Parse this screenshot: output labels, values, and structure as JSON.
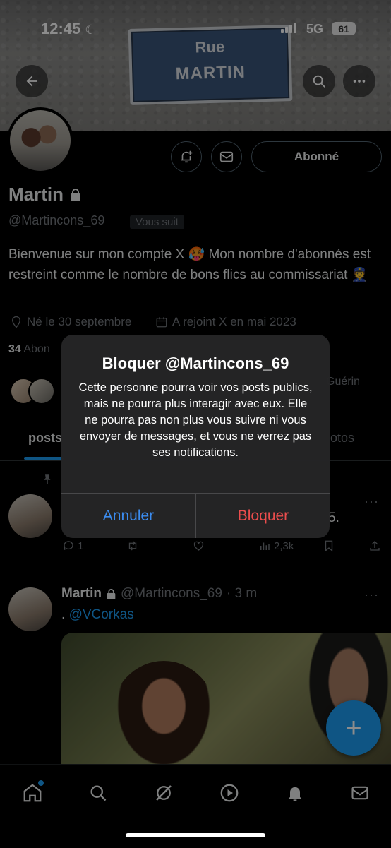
{
  "status_bar": {
    "time": "12:45",
    "network": "5G",
    "battery": "61"
  },
  "banner": {
    "sign_line1": "Rue",
    "sign_line2": "MARTIN"
  },
  "profile": {
    "name": "Martin",
    "handle": "@Martincons_69",
    "follows_you": "Vous suit",
    "follow_button": "Abonné",
    "bio": "Bienvenue sur mon compte X 🥵 Mon nombre d'abonnés est restreint comme le nombre de bons flics au commissariat 👮",
    "birthday": "Né le 30 septembre",
    "joined": "A rejoint X en mai 2023",
    "following_count": "34",
    "following_label_partial": "Abon",
    "followed_by_partial": "Guérin"
  },
  "tabs": {
    "first_partial": "posts",
    "last_partial": "otos"
  },
  "post1": {
    "text_end": "5.",
    "replies": "1",
    "views": "2,3k"
  },
  "post2": {
    "author": "Martin",
    "handle": "@Martincons_69",
    "time": "· 3 m",
    "text_prefix": ".",
    "mention": "@VCorkas"
  },
  "fab": {
    "label": "+"
  },
  "dialog": {
    "title": "Bloquer @Martincons_69",
    "message": "Cette personne pourra voir vos posts publics, mais ne pourra plus interagir avec eux. Elle ne pourra pas non plus vous suivre ni vous envoyer de messages, et vous ne verrez pas ses notifications.",
    "cancel": "Annuler",
    "confirm": "Bloquer"
  },
  "colors": {
    "accent": "#1d9bf0",
    "destructive": "#eb4d4d",
    "ios_blue": "#3b8cf0"
  },
  "icons": [
    "back-arrow-icon",
    "search-icon",
    "more-icon",
    "notification-bell-plus-icon",
    "mail-icon",
    "lock-icon",
    "location-pin-icon",
    "calendar-icon",
    "pin-icon",
    "reply-icon",
    "retweet-icon",
    "like-icon",
    "views-icon",
    "bookmark-icon",
    "share-icon",
    "home-icon",
    "explore-icon",
    "grok-icon",
    "video-icon",
    "notifications-icon",
    "messages-icon"
  ]
}
